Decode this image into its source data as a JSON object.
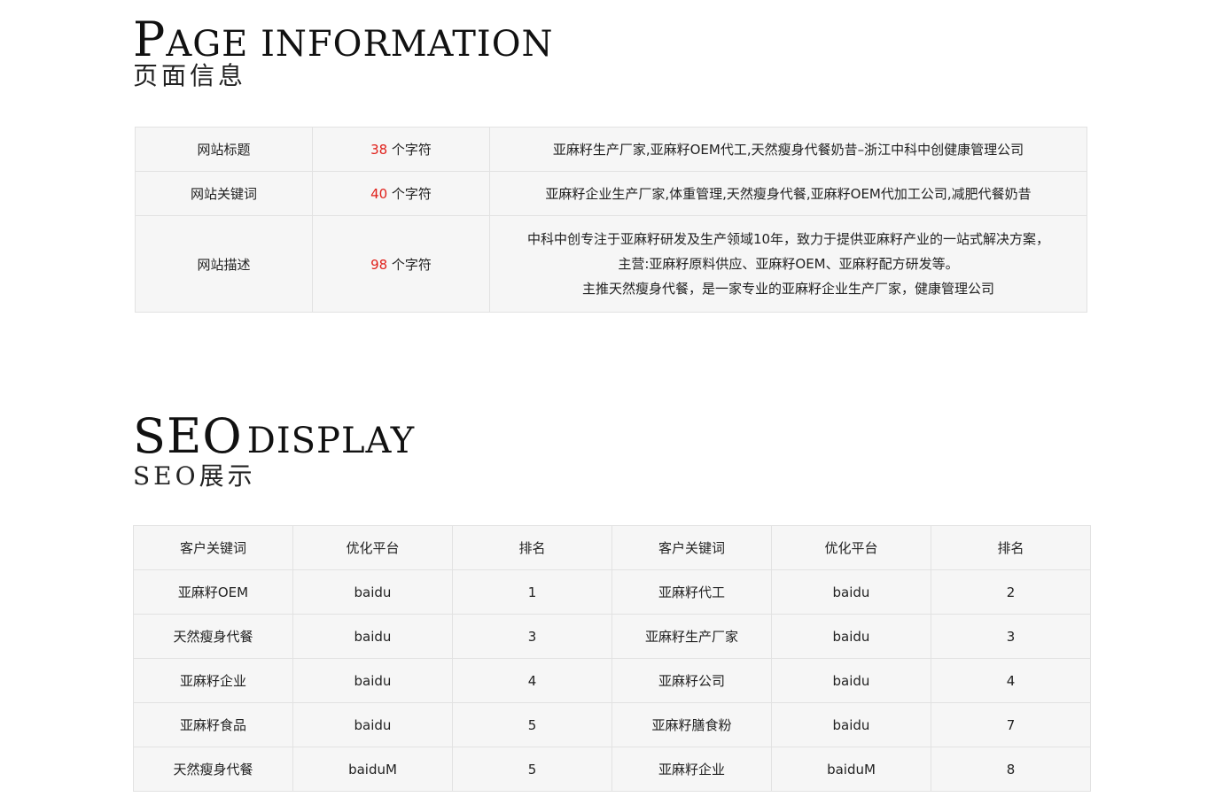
{
  "page_info": {
    "title_initial": "P",
    "title_rest": "age information",
    "subtitle": "页面信息",
    "rows": [
      {
        "label": "网站标题",
        "count": "38",
        "unit": " 个字符",
        "content": [
          "亚麻籽生产厂家,亚麻籽OEM代工,天然瘦身代餐奶昔–浙江中科中创健康管理公司"
        ]
      },
      {
        "label": "网站关键词",
        "count": "40",
        "unit": " 个字符",
        "content": [
          "亚麻籽企业生产厂家,体重管理,天然瘦身代餐,亚麻籽OEM代加工公司,减肥代餐奶昔"
        ]
      },
      {
        "label": "网站描述",
        "count": "98",
        "unit": " 个字符",
        "content": [
          "中科中创专注于亚麻籽研发及生产领域10年，致力于提供亚麻籽产业的一站式解决方案，",
          "主营:亚麻籽原料供应、亚麻籽OEM、亚麻籽配方研发等。",
          "主推天然瘦身代餐，是一家专业的亚麻籽企业生产厂家，健康管理公司"
        ]
      }
    ]
  },
  "seo": {
    "title_big": "SEO",
    "title_rest": "display",
    "subtitle": "SEO展示",
    "headers": [
      "客户关键词",
      "优化平台",
      "排名",
      "客户关键词",
      "优化平台",
      "排名"
    ],
    "rows": [
      [
        "亚麻籽OEM",
        "baidu",
        "1",
        "亚麻籽代工",
        "baidu",
        "2"
      ],
      [
        "天然瘦身代餐",
        "baidu",
        "3",
        "亚麻籽生产厂家",
        "baidu",
        "3"
      ],
      [
        "亚麻籽企业",
        "baidu",
        "4",
        "亚麻籽公司",
        "baidu",
        "4"
      ],
      [
        "亚麻籽食品",
        "baidu",
        "5",
        "亚麻籽膳食粉",
        "baidu",
        "7"
      ],
      [
        "天然瘦身代餐",
        "baiduM",
        "5",
        "亚麻籽企业",
        "baiduM",
        "8"
      ]
    ]
  }
}
